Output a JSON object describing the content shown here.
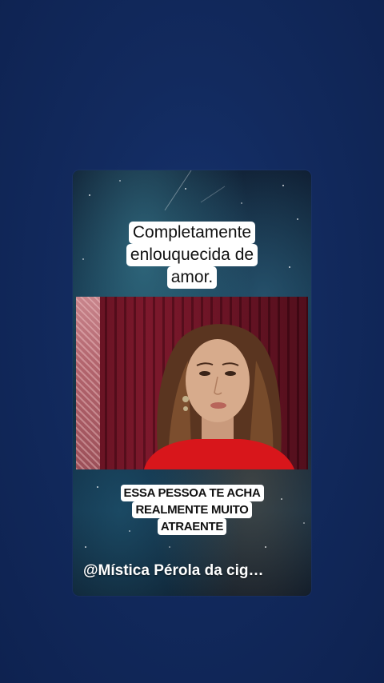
{
  "post": {
    "top_caption_lines": [
      "Completamente",
      "enlouquecida de",
      "amor."
    ],
    "bottom_caption_lines": [
      "ESSA PESSOA TE ACHA",
      "REALMENTE MUITO",
      "ATRAENTE"
    ],
    "author_handle": "@Mística Pérola da cig…"
  },
  "colors": {
    "page_background": "#122a5e",
    "curtain": "#7a1428",
    "caption_bg": "#ffffff",
    "caption_text": "#111111",
    "dress": "#d8161b"
  }
}
